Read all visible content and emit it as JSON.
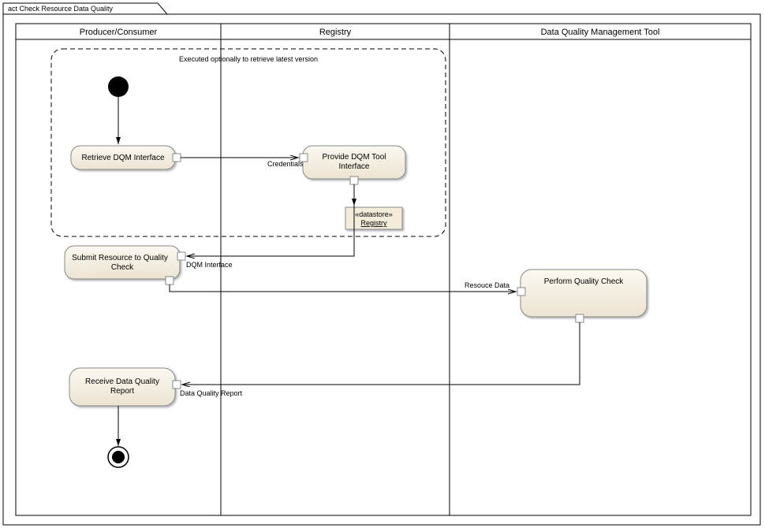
{
  "title": "act Check Resource Data Quality",
  "lanes": {
    "producer": "Producer/Consumer",
    "registry": "Registry",
    "dqm": "Data Quality Management Tool"
  },
  "region": {
    "label": "Executed optionally to retrieve latest version"
  },
  "nodes": {
    "retrieve": "Retrieve DQM Interface",
    "provide1": "Provide DQM Tool",
    "provide2": "Interface",
    "datastore_stereo": "«datastore»",
    "datastore_name": "Registry",
    "submit1": "Submit Resource to Quality",
    "submit2": "Check",
    "perform": "Perform Quality Check",
    "receive1": "Receive Data Quality",
    "receive2": "Report"
  },
  "edges": {
    "credentials": "Credentials",
    "dqmInterface": "DQM Interface",
    "resourceData": "Resouce Data",
    "report": "Data Quality Report"
  }
}
